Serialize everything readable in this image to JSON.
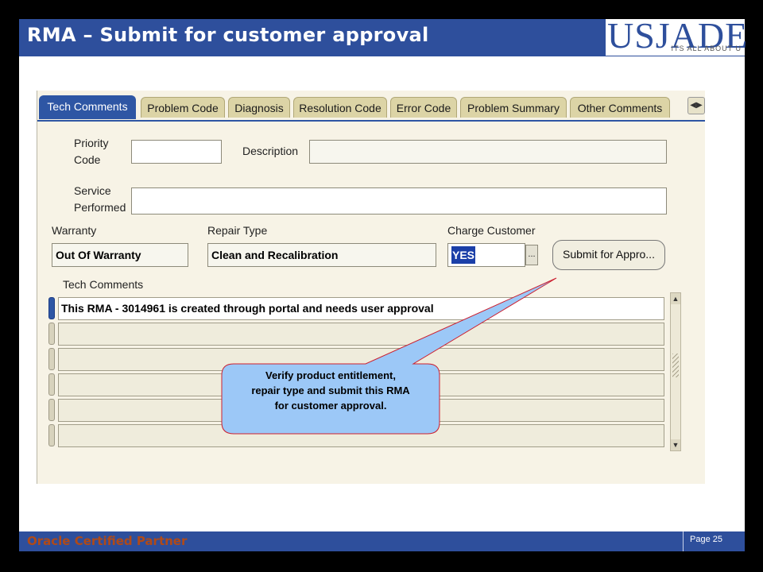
{
  "slide": {
    "title": "RMA – Submit for customer approval",
    "logo": {
      "main": "USJADE",
      "tagline": "ITS ALL ABOUT U"
    },
    "footer": {
      "partner": "Oracle Certified Partner",
      "page": "Page 25"
    }
  },
  "form": {
    "tabs": [
      {
        "label": "Tech Comments",
        "active": true
      },
      {
        "label": "Problem Code"
      },
      {
        "label": "Diagnosis"
      },
      {
        "label": "Resolution Code"
      },
      {
        "label": "Error Code"
      },
      {
        "label": "Problem Summary"
      },
      {
        "label": "Other Comments"
      }
    ],
    "priority_code": {
      "label_line1": "Priority",
      "label_line2": "Code",
      "value": ""
    },
    "description": {
      "label": "Description",
      "value": ""
    },
    "service_performed": {
      "label_line1": "Service",
      "label_line2": "Performed",
      "value": ""
    },
    "warranty": {
      "label": "Warranty",
      "value": "Out Of Warranty"
    },
    "repair_type": {
      "label": "Repair Type",
      "value": "Clean and Recalibration"
    },
    "charge_customer": {
      "label": "Charge Customer",
      "value": "YES",
      "lov_button": "..."
    },
    "submit_button": "Submit for Appro...",
    "tech_comments": {
      "label": "Tech Comments",
      "rows": [
        "This RMA - 3014961 is created through portal and needs user approval",
        "",
        "",
        "",
        "",
        ""
      ]
    }
  },
  "callout": {
    "line1": "Verify product entitlement,",
    "line2": "repair type and submit this RMA",
    "line3": "for customer approval."
  },
  "colors": {
    "title_bar": "#2e4f9c",
    "active_tab": "#2e56a4",
    "callout_fill": "#9cc8f7",
    "callout_border": "#cc1f2f",
    "footer_partner": "#b04a18"
  }
}
